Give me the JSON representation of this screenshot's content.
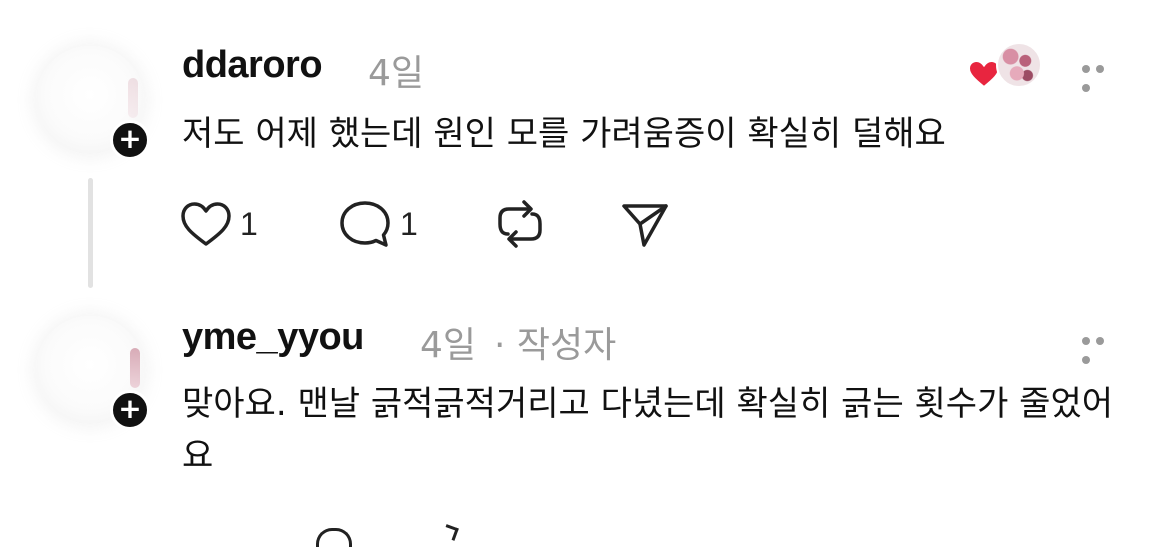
{
  "comments": [
    {
      "username": "ddaroro",
      "time": "4일",
      "text": "저도 어제 했는데 원인 모를 가려움증이 확실히 덜해요",
      "likes": "1",
      "replies": "1",
      "icons": {
        "like": "heart-outline",
        "reply": "speech-bubble",
        "repost": "repost-arrows",
        "share": "paper-plane",
        "more": "ellipsis",
        "liked_by_author": "heart-filled"
      },
      "colors": {
        "heart_badge": "#e8253f"
      }
    },
    {
      "username": "yme_yyou",
      "time": "4일",
      "author_tag": "· 작성자",
      "text": "맞아요. 맨날 긁적긁적거리고 다녔는데 확실히 긁는 횟수가 줄었어요",
      "icons": {
        "more": "ellipsis"
      }
    }
  ]
}
